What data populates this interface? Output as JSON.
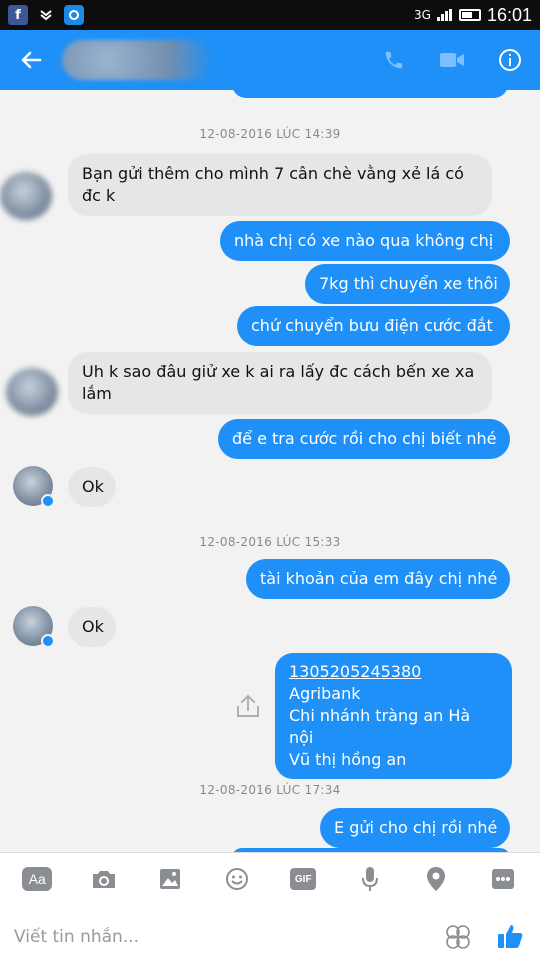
{
  "status_bar": {
    "network": "3G",
    "time": "16:01"
  },
  "header": {
    "contact_name_hidden": true
  },
  "thread": {
    "timestamps": [
      "12-08-2016 LÚC 14:39",
      "12-08-2016 LÚC 15:33",
      "12-08-2016 LÚC 17:34"
    ],
    "messages": [
      {
        "from": "them",
        "text": "Bạn gửi thêm cho mình 7 cân chè vằng xẻ lá có đc k"
      },
      {
        "from": "me",
        "text": "nhà chị có xe nào qua không chị"
      },
      {
        "from": "me",
        "text": "7kg thì chuyển xe thôi"
      },
      {
        "from": "me",
        "text": "chứ chuyển bưu điện cước đắt"
      },
      {
        "from": "them",
        "text": "Uh k sao đâu giử xe k ai ra lấy đc cách bến xe xa lắm"
      },
      {
        "from": "me",
        "text": "để e tra cước rồi cho chị biết nhé"
      },
      {
        "from": "them",
        "text": "Ok"
      },
      {
        "from": "me",
        "text": "tài khoản của em đây chị nhé"
      },
      {
        "from": "them",
        "text": "Ok"
      },
      {
        "from": "me",
        "lines": [
          "1305205245380",
          "Agribank",
          "Chi nhánh tràng an Hà nội",
          "Vũ thị hồng an"
        ]
      },
      {
        "from": "me",
        "text": "E gửi cho chị rồi nhé"
      }
    ]
  },
  "composer": {
    "aa_label": "Aa",
    "gif_label": "GIF",
    "placeholder": "Viết tin nhắn..."
  },
  "colors": {
    "accent": "#1e90f7",
    "incoming_bubble": "#e4e6e8",
    "background": "#f2f2f2"
  }
}
